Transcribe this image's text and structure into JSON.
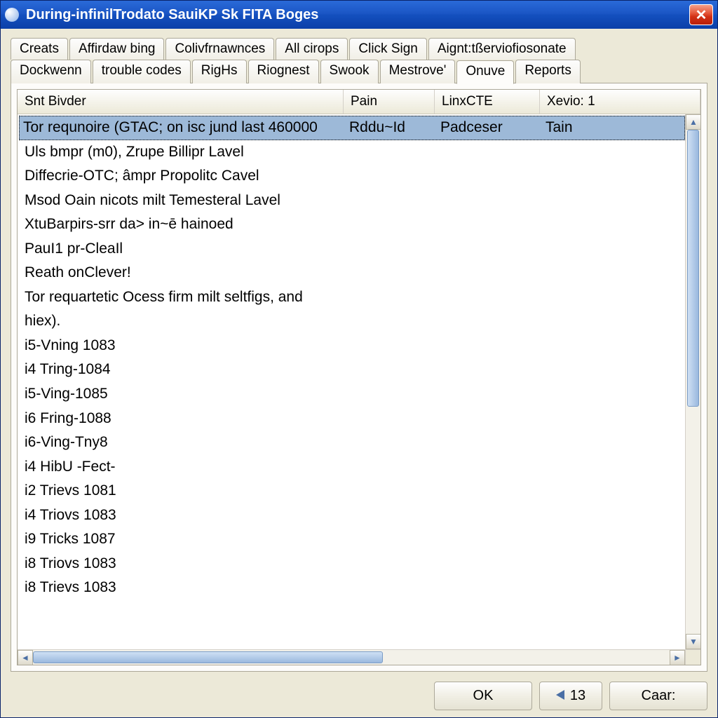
{
  "window": {
    "title": "During-infinilTrodato SauiKP Sk FITA Boges"
  },
  "tabs_row1": [
    {
      "label": "Creats"
    },
    {
      "label": "Affirdaw bing"
    },
    {
      "label": "Colivfrnawnces"
    },
    {
      "label": "All cirops"
    },
    {
      "label": "Click Sign"
    },
    {
      "label": "Aignt:tßerviofiosonate"
    }
  ],
  "tabs_row2": [
    {
      "label": "Dockwenn"
    },
    {
      "label": "trouble codes"
    },
    {
      "label": "RigHs"
    },
    {
      "label": "Riognest"
    },
    {
      "label": "Swook"
    },
    {
      "label": "Mestrove'"
    },
    {
      "label": "Onuve",
      "active": true
    },
    {
      "label": "Reports"
    }
  ],
  "columns": [
    "Snt Bivder",
    "Pain",
    "LinxCTE",
    "Xevio: 1"
  ],
  "selected_row": {
    "c0": "Tor requnoire (GTAC; on isc jund last 460000",
    "c1": "Rddu~Id",
    "c2": "Padceser",
    "c3": "Tain"
  },
  "rows": [
    "Uls bmpr (m0), Zrupe Billipr Lavel",
    "Diffecrie-OTC; âmpr Propolitc Cavel",
    "Msod Oain nicots milt Temesteral Lavel",
    "XtuBarpirs-srr da> in~ē hainoed",
    "PauI1 pr-CleaIl",
    "Reath onClever!",
    "Tor requartetic Ocess firm milt seltfigs, and",
    "hiex).",
    "i5-Vning 1083",
    "i4 Tring-1084",
    "i5-Ving-1085",
    "i6 Fring-1088",
    "i6-Ving-Tny8",
    "i4 HibU -Fect-",
    "i2 Trievs 1081",
    "i4 Triovs 1083",
    "i9 Tricks 1087",
    "i8 Triovs 1083",
    "i8 Trievs 1083"
  ],
  "buttons": {
    "ok": "OK",
    "back_num": "13",
    "cancel": "Caar:"
  }
}
